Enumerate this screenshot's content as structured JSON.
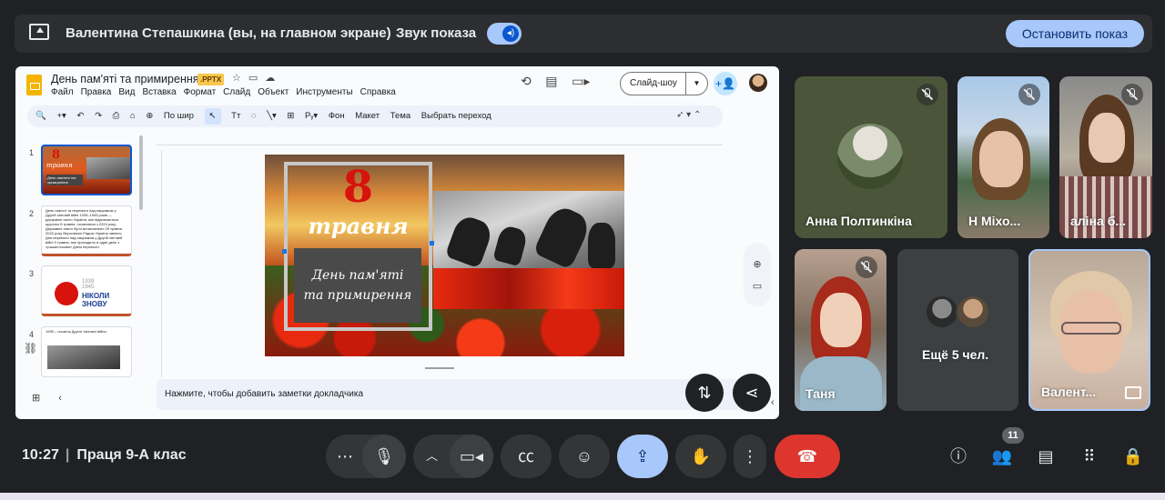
{
  "banner": {
    "presenter_text": "Валентина Степашкина (вы, на главном экране)",
    "sound_label": "Звук показа",
    "stop_button": "Остановить показ"
  },
  "editor": {
    "doc_title": "День пам'яті та примирення",
    "file_badge": ".PPTX",
    "menus": [
      "Файл",
      "Правка",
      "Вид",
      "Вставка",
      "Формат",
      "Слайд",
      "Объект",
      "Инструменты",
      "Справка"
    ],
    "slideshow_button": "Слайд-шоу",
    "toolbar": {
      "zoom_label": "По шир",
      "background": "Фон",
      "layout": "Макет",
      "theme": "Тема",
      "transition": "Выбрать переход"
    },
    "thumbnails": [
      {
        "num": "1",
        "line1": "8",
        "line2": "травня",
        "line3": "День пам'яті та примирення"
      },
      {
        "num": "2",
        "text": "День пам'яті та перемоги над нацизмом у Другій світовій війні 1939–1945 років — державне свято України, яке відзначається щорічно 8 травня, починаючи з 2024 року. Державне свято було встановлено 29 травня 2023 року Верховною Радою України замість Дня перемоги над нацизмом у Другій світовій війні 9 травня, яке приходило в один день з «рашистським» Днем перемоги."
      },
      {
        "num": "3",
        "line1": "1939",
        "line2": "1945",
        "line3": "НІКОЛИ",
        "line4": "ЗНОВУ"
      },
      {
        "num": "4",
        "text": "1939 – початок Другої світової війни"
      }
    ],
    "slide": {
      "number": "8",
      "month": "травня",
      "subtitle_line1": "День пам'яті",
      "subtitle_line2": "та примирення"
    },
    "notes_placeholder": "Нажмите, чтобы добавить заметки докладчика"
  },
  "participants": [
    {
      "name": "Анна Полтинкіна",
      "muted": true
    },
    {
      "name": "Н Міхо...",
      "muted": true
    },
    {
      "name": "аліна б...",
      "muted": true
    },
    {
      "name": "Таня",
      "muted": true
    },
    {
      "name": "Ещё 5 чел.",
      "muted": false
    },
    {
      "name": "Валент...",
      "muted": false
    }
  ],
  "bottom": {
    "time": "10:27",
    "meeting_name": "Праця 9-А клас",
    "people_count": "11"
  },
  "colors": {
    "accent_blue": "#a8c7fa",
    "hangup_red": "#dc362e",
    "background": "#202124"
  }
}
